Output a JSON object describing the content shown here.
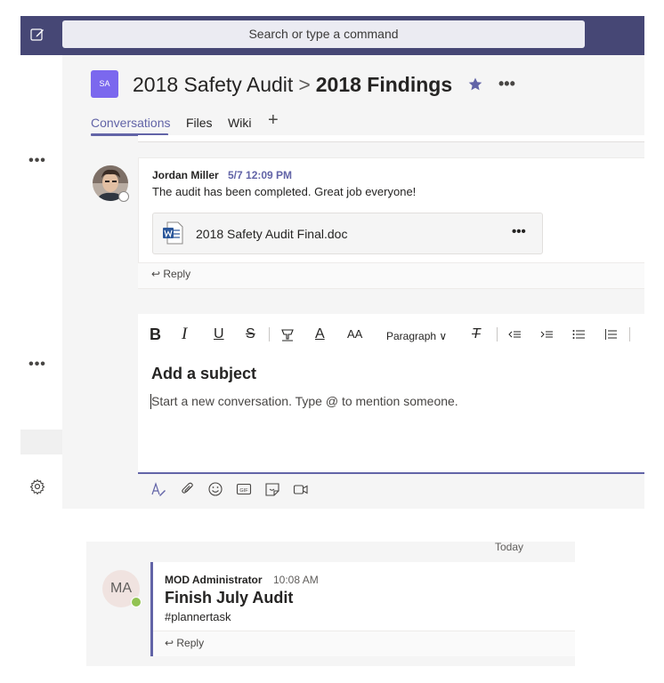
{
  "search": {
    "label": "Search or type a command"
  },
  "rail": {
    "more1": "•••",
    "more2": "•••"
  },
  "channel": {
    "avatar_initials": "SA",
    "team_name": "2018 Safety Audit",
    "separator": ">",
    "channel_name": "2018 Findings",
    "more": "•••",
    "tabs": [
      {
        "label": "Conversations"
      },
      {
        "label": "Files"
      },
      {
        "label": "Wiki"
      }
    ],
    "add_tab": "+"
  },
  "message": {
    "author": "Jordan Miller",
    "time": "5/7 12:09 PM",
    "body": "The audit has been completed. Great job everyone!",
    "attachment": {
      "name": "2018 Safety Audit Final.doc",
      "more": "•••"
    },
    "reply_label": "↩ Reply"
  },
  "compose": {
    "format": {
      "bold": "B",
      "italic": "I",
      "underline": "U",
      "strike": "S",
      "font_color": "A",
      "font_size": "AA",
      "paragraph": "Paragraph ∨",
      "clear": "T"
    },
    "subject_placeholder": "Add a subject",
    "body_placeholder": "Start a new conversation. Type @ to mention someone."
  },
  "lower": {
    "date_divider": "Today",
    "avatar_initials": "MA",
    "author": "MOD Administrator",
    "time": "10:08 AM",
    "title": "Finish July Audit",
    "tag": "#plannertask",
    "reply_label": "↩ Reply"
  },
  "colors": {
    "brand": "#464775",
    "accent": "#6264a7",
    "presence_available": "#92c353"
  }
}
